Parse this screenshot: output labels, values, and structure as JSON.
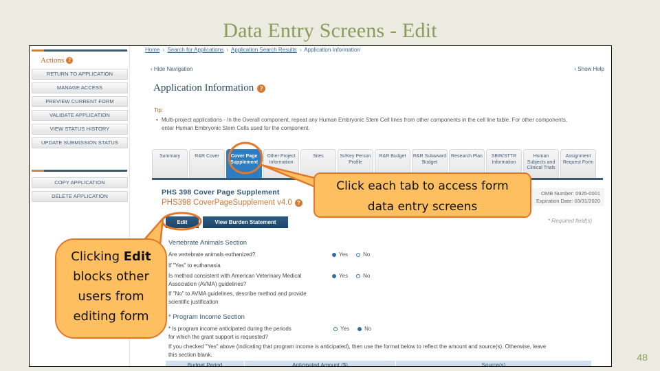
{
  "slide": {
    "title": "Data Entry Screens - Edit",
    "page_number": "48"
  },
  "sidebar": {
    "actions_title": "Actions",
    "help_icon": "?",
    "buttons": [
      "RETURN TO APPLICATION",
      "MANAGE ACCESS",
      "PREVIEW CURRENT FORM",
      "VALIDATE APPLICATION",
      "VIEW STATUS HISTORY",
      "UPDATE SUBMISSION STATUS"
    ],
    "secondary_buttons": [
      "COPY APPLICATION",
      "DELETE APPLICATION"
    ]
  },
  "breadcrumb": {
    "items": [
      "Home",
      "Search for Applications",
      "Application Search Results"
    ],
    "current": "Application Information",
    "separator": "›"
  },
  "nav": {
    "hide_navigation": "‹ Hide Navigation",
    "show_help": "‹ Show Help"
  },
  "page": {
    "title": "Application Information",
    "tip_label": "Tip:",
    "tip_bullet": "•",
    "tip_text": "Multi-project applications - In the Overall component, repeat any Human Embryonic Stem Cell lines from other components in the cell line table. For other components, enter Human Embryonic Stem Cells used for the component."
  },
  "tabs": [
    {
      "label": "Summary",
      "active": false
    },
    {
      "label": "R&R Cover",
      "active": false
    },
    {
      "label": "Cover Page Supplement",
      "active": true
    },
    {
      "label": "Other Project Information",
      "active": false
    },
    {
      "label": "Sites",
      "active": false
    },
    {
      "label": "Sr/Key Person Profile",
      "active": false
    },
    {
      "label": "R&R Budget",
      "active": false
    },
    {
      "label": "R&R Subaward Budget",
      "active": false
    },
    {
      "label": "Research Plan",
      "active": false
    },
    {
      "label": "SBIR/STTR Information",
      "active": false
    },
    {
      "label": "Human Subjects and Clinical Trials",
      "active": false
    },
    {
      "label": "Assignment Request Form",
      "active": false
    }
  ],
  "form": {
    "title": "PHS 398 Cover Page Supplement",
    "version": "PHS398 CoverPageSupplement v4.0",
    "omb_number": "OMB Number: 0925-0001",
    "expiration": "Expiration Date: 03/31/2020",
    "required_note": "* Required field(s)",
    "edit_button": "Edit",
    "burden_button": "View Burden Statement"
  },
  "sections": {
    "vertebrate": {
      "heading": "Vertebrate Animals Section",
      "q1": "Are vertebrate animals euthanized?",
      "q1_answer": "Yes",
      "q1_sub": "If \"Yes\" to euthanasia",
      "q2_line1": "Is method consistent with American Veterinary Medical",
      "q2_line2": "Association (AVMA) guidelines?",
      "q2_answer": "Yes",
      "q3_line1": "If \"No\" to AVMA guidelines, describe method and provide",
      "q3_line2": "scientific justification"
    },
    "program_income": {
      "heading": "* Program Income Section",
      "q_line1": "* Is program income anticipated during the periods",
      "q_line2": "for which the grant support is requested?",
      "q_answer": "No",
      "note_line1": "If you checked \"Yes\" above (indicating that program income is anticipated), then use the format below to reflect the amount and source(s). Otherwise, leave",
      "note_line2": "this section blank.",
      "table_headers": [
        "Budget Period",
        "Anticipated Amount ($)",
        "Source(s)"
      ]
    },
    "radio_labels": {
      "yes": "Yes",
      "no": "No"
    }
  },
  "callouts": {
    "tabs": {
      "line1": "Click each tab to access form",
      "line2": "data entry screens"
    },
    "edit": {
      "pre": "Clicking ",
      "bold": "Edit",
      "rest1": "blocks other",
      "rest2": "users from",
      "rest3": "editing form"
    }
  },
  "colors": {
    "callout_fill": "#fdbf5f",
    "callout_border": "#e3772a",
    "active_tab": "#2f7dc1",
    "primary_button": "#1d4468",
    "title_green": "#8a9b5a"
  }
}
